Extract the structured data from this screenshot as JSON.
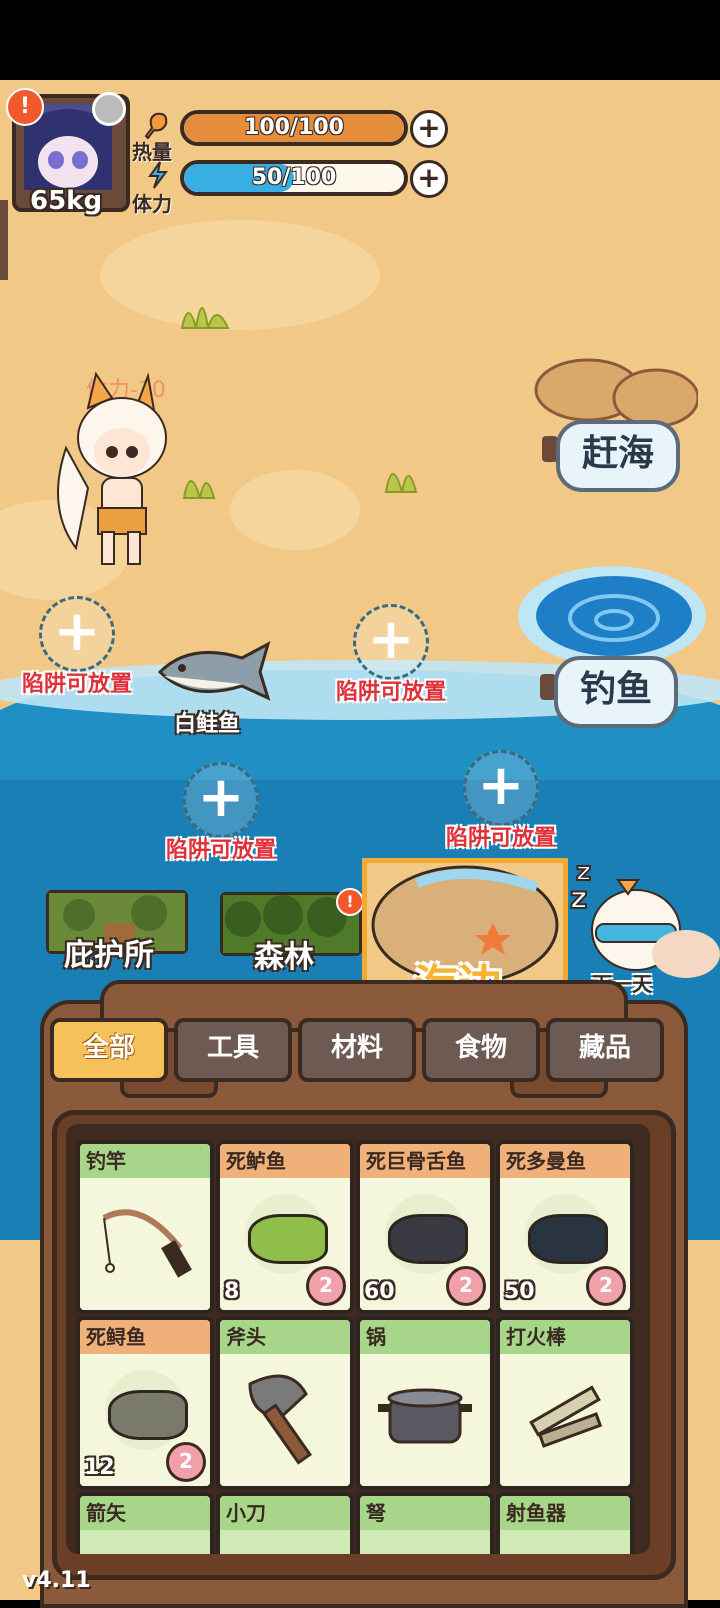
{
  "hud": {
    "weight": "65kg",
    "calories": {
      "label": "热量",
      "text": "100/100",
      "value": 100,
      "max": 100,
      "color": "#e48d3c"
    },
    "stamina": {
      "label": "体力",
      "text": "50/100",
      "value": 50,
      "max": 100,
      "color": "#39aee3"
    }
  },
  "scene": {
    "floating_text": "体力-10",
    "beachcomb_label": "赶海",
    "fishing_label": "钓鱼",
    "fish_label": "白鲑鱼",
    "traps": [
      "陷阱可放置",
      "陷阱可放置",
      "陷阱可放置",
      "陷阱可放置"
    ]
  },
  "locations": {
    "shelter": "庇护所",
    "forest": "森林",
    "beach": "海边",
    "next_day": "下一天"
  },
  "inventory": {
    "tabs": [
      "全部",
      "工具",
      "材料",
      "食物",
      "藏品"
    ],
    "active_tab": "全部",
    "items": [
      {
        "name": "钓竿",
        "type": "tool"
      },
      {
        "name": "死鲈鱼",
        "type": "food",
        "qty": "8",
        "cal": "2",
        "mult": "×2"
      },
      {
        "name": "死巨骨舌鱼",
        "type": "food",
        "qty": "60",
        "cal": "2"
      },
      {
        "name": "死多曼鱼",
        "type": "food",
        "qty": "50",
        "cal": "2"
      },
      {
        "name": "死鲟鱼",
        "type": "food",
        "qty": "12",
        "cal": "2"
      },
      {
        "name": "斧头",
        "type": "tool"
      },
      {
        "name": "锅",
        "type": "tool"
      },
      {
        "name": "打火棒",
        "type": "tool"
      },
      {
        "name": "箭矢",
        "type": "tool"
      },
      {
        "name": "小刀",
        "type": "tool"
      },
      {
        "name": "弩",
        "type": "tool"
      },
      {
        "name": "射鱼器",
        "type": "tool"
      }
    ]
  },
  "version": "v4.11"
}
